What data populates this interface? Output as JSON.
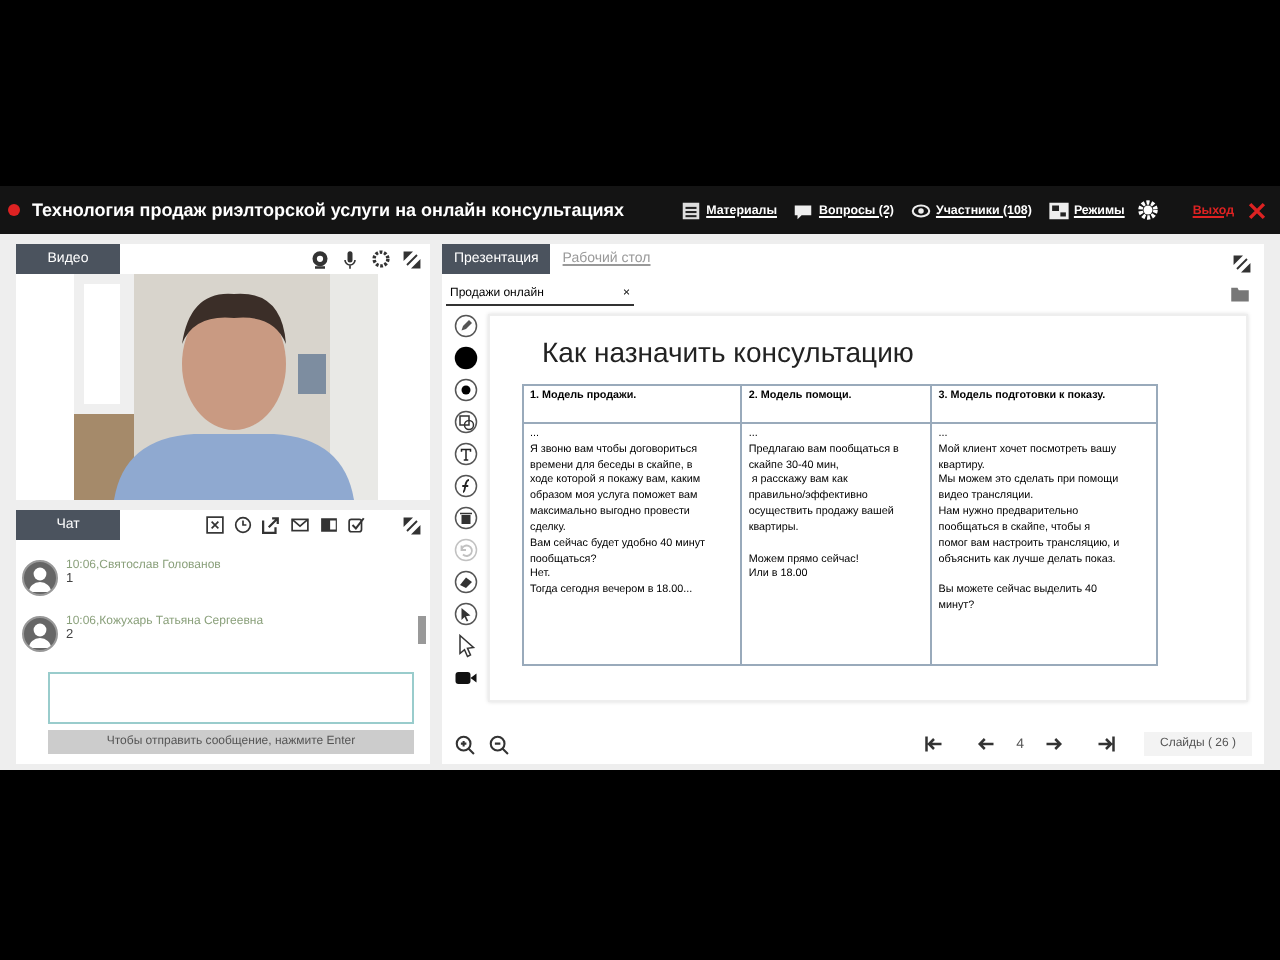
{
  "header": {
    "title": "Технология продаж риэлторской услуги на онлайн консультациях",
    "links": [
      {
        "kind": "materials",
        "label": "Материалы"
      },
      {
        "kind": "questions",
        "label": "Вопросы (2)"
      },
      {
        "kind": "participants",
        "label": "Участники (108)"
      },
      {
        "kind": "modes",
        "label": "Режимы"
      }
    ],
    "exit": "Выход"
  },
  "video": {
    "tab": "Видео"
  },
  "chat": {
    "tab": "Чат",
    "messages": [
      {
        "meta": "10:06,Святослав Голованов",
        "text": "1"
      },
      {
        "meta": "10:06,Кожухарь Татьяна Сергеевна",
        "text": "2"
      }
    ],
    "send_hint": "Чтобы отправить сообщение, нажмите Enter"
  },
  "presentation": {
    "tabs": [
      {
        "label": "Презентация",
        "selected": true
      },
      {
        "label": "Рабочий стол",
        "selected": false
      }
    ],
    "document_tab": "Продажи онлайн",
    "close": "×",
    "tools": [
      {
        "kind": "pencil",
        "disabled": false
      },
      {
        "kind": "big-dot",
        "disabled": false
      },
      {
        "kind": "small-dot",
        "disabled": false
      },
      {
        "kind": "shapes",
        "disabled": false
      },
      {
        "kind": "text",
        "disabled": false
      },
      {
        "kind": "formula",
        "disabled": false
      },
      {
        "kind": "trash",
        "disabled": false
      },
      {
        "kind": "undo",
        "disabled": true
      },
      {
        "kind": "eraser",
        "disabled": false
      },
      {
        "kind": "pointer",
        "disabled": false
      },
      {
        "kind": "cursor",
        "disabled": false
      },
      {
        "kind": "camera",
        "disabled": false
      }
    ],
    "slide": {
      "title": "Как назначить консультацию",
      "columns": [
        "1. Модель продажи.",
        "2. Модель помощи.",
        "3. Модель подготовки к показу."
      ],
      "cells": [
        "...\nЯ звоню вам чтобы договориться\nвремени для беседы в скайпе, в\nходе которой я покажу вам, каким\nобразом моя услуга поможет вам\nмаксимально выгодно провести\nсделку.\nВам сейчас будет удобно 40 минут\nпообщаться?\nНет.\nТогда сегодня вечером в 18.00...",
        "...\nПредлагаю вам пообщаться в\nскайпе 30-40 мин,\n я расскажу вам как\nправильно/эффективно\nосуществить продажу вашей\nквартиры.\n\nМожем прямо сейчас!\nИли в 18.00",
        "...\nМой клиент хочет посмотреть вашу\nквартиру.\nМы можем это сделать при помощи\nвидео трансляции.\nНам нужно предварительно\nпообщаться в скайпе, чтобы я\nпомог вам настроить трансляцию, и\nобъяснить как лучше делать показ.\n\nВы можете сейчас выделить 40\nминут?"
      ]
    },
    "page": "4",
    "slides_count": "Слайды ( 26 )"
  }
}
